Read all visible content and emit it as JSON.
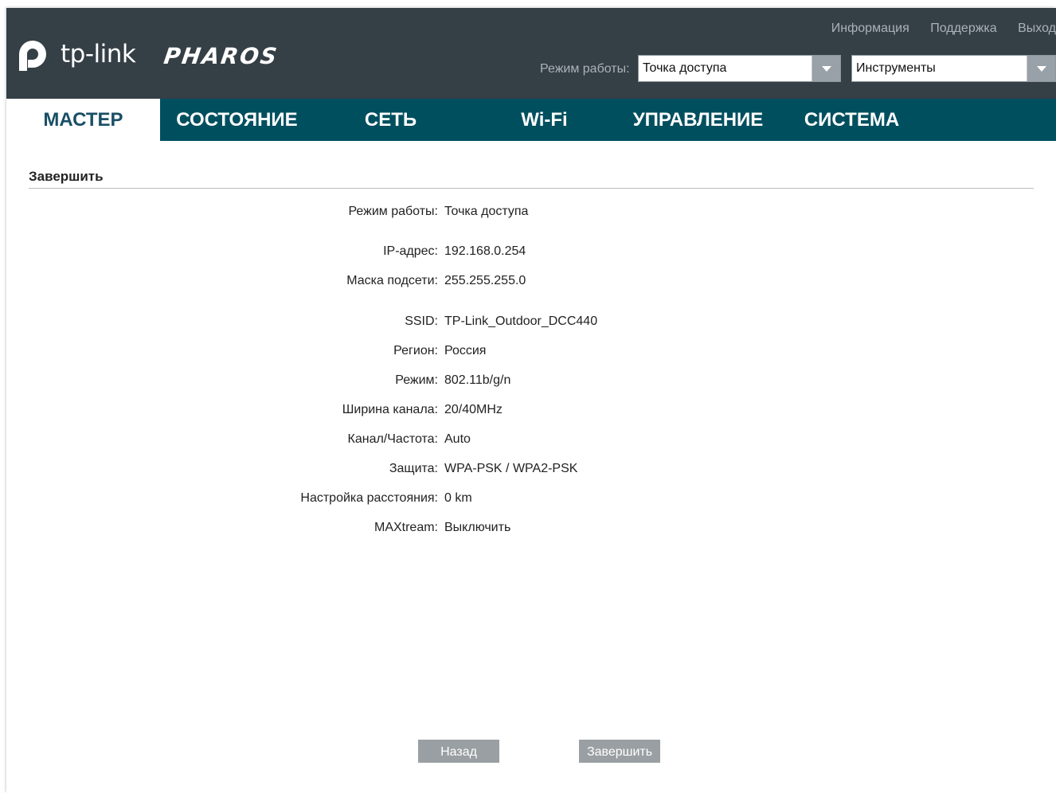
{
  "header": {
    "brand": "tp-link",
    "product": "PHAROS",
    "links": [
      "Информация",
      "Поддержка",
      "Выход"
    ],
    "mode_label": "Режим работы:",
    "mode_value": "Точка доступа",
    "tools_value": "Инструменты"
  },
  "nav": {
    "tabs": [
      "МАСТЕР",
      "СОСТОЯНИЕ",
      "СЕТЬ",
      "Wi-Fi",
      "УПРАВЛЕНИЕ",
      "СИСТЕМА"
    ],
    "active": "МАСТЕР"
  },
  "section": {
    "title": "Завершить"
  },
  "summary": [
    {
      "label": "Режим работы:",
      "value": "Точка доступа"
    },
    {
      "label": "IP-адрес:",
      "value": "192.168.0.254"
    },
    {
      "label": "Маска подсети:",
      "value": "255.255.255.0"
    },
    {
      "label": "SSID:",
      "value": "TP-Link_Outdoor_DCC440"
    },
    {
      "label": "Регион:",
      "value": "Россия"
    },
    {
      "label": "Режим:",
      "value": "802.11b/g/n"
    },
    {
      "label": "Ширина канала:",
      "value": "20/40MHz"
    },
    {
      "label": "Канал/Частота:",
      "value": "Auto"
    },
    {
      "label": "Защита:",
      "value": "WPA-PSK / WPA2-PSK"
    },
    {
      "label": "Настройка расстояния:",
      "value": "0 km"
    },
    {
      "label": "MAXtream:",
      "value": "Выключить"
    }
  ],
  "buttons": {
    "back": "Назад",
    "finish": "Завершить"
  },
  "colors": {
    "header_bg": "#353f46",
    "nav_bg": "#004f5f",
    "active_tab_text": "#1a4f66",
    "button_bg": "#999fa3"
  }
}
